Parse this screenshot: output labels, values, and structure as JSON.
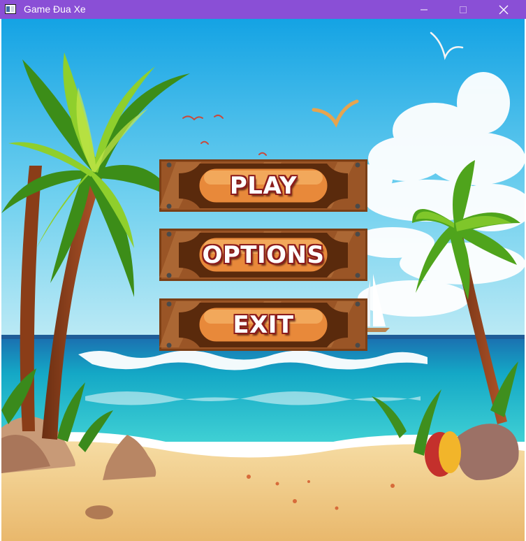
{
  "window": {
    "title": "Game Đua Xe",
    "icon": "app-window-icon",
    "controls": [
      "minimize-icon",
      "maximize-icon",
      "close-icon"
    ]
  },
  "menu": {
    "play_label": "PLAY",
    "options_label": "OPTIONS",
    "exit_label": "EXIT"
  },
  "colors": {
    "titlebar": "#8a4fd6",
    "sky_top": "#19a8e6",
    "sea": "#17b6c9",
    "sand": "#f1cf86",
    "plank": "#8a4d1f",
    "pill": "#e98f3c",
    "label_outline": "#8b1c1c"
  }
}
